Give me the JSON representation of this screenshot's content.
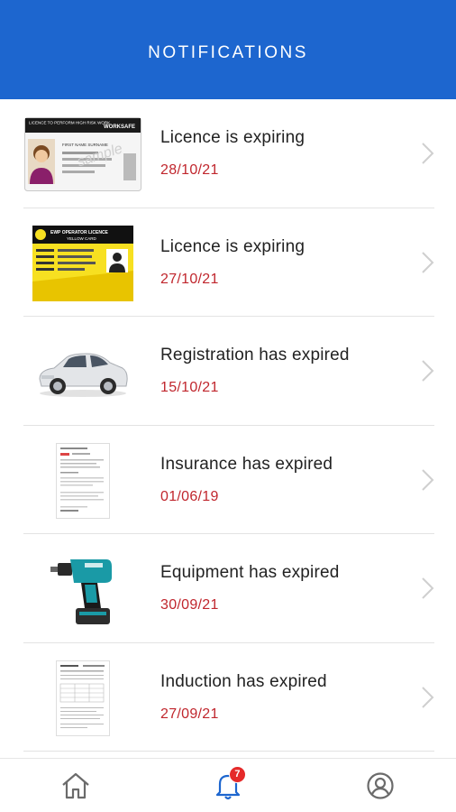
{
  "header": {
    "title": "NOTIFICATIONS"
  },
  "notifications": [
    {
      "title": "Licence is expiring",
      "date": "28/10/21",
      "thumb": "high-risk-licence-card"
    },
    {
      "title": "Licence is expiring",
      "date": "27/10/21",
      "thumb": "yellow-operator-licence-card"
    },
    {
      "title": "Registration has expired",
      "date": "15/10/21",
      "thumb": "car"
    },
    {
      "title": "Insurance has expired",
      "date": "01/06/19",
      "thumb": "document"
    },
    {
      "title": "Equipment has expired",
      "date": "30/09/21",
      "thumb": "power-drill"
    },
    {
      "title": "Induction has expired",
      "date": "27/09/21",
      "thumb": "form-document"
    }
  ],
  "licence_card": {
    "header": "LICENCE TO PERFORM HIGH RISK WORK",
    "brand": "WORKSAFE",
    "watermark": "sample",
    "name": "FIRST NAME SURNAME"
  },
  "operator_card": {
    "header": "EWP OPERATOR LICENCE",
    "subheader": "YELLOW CARD"
  },
  "bottom_nav": {
    "home": "home-icon",
    "notifications": "bell-icon",
    "notification_count": "7",
    "profile": "user-circle-icon"
  },
  "colors": {
    "header": "#1d66cf",
    "date": "#c0262d",
    "badge": "#e52a2a"
  }
}
